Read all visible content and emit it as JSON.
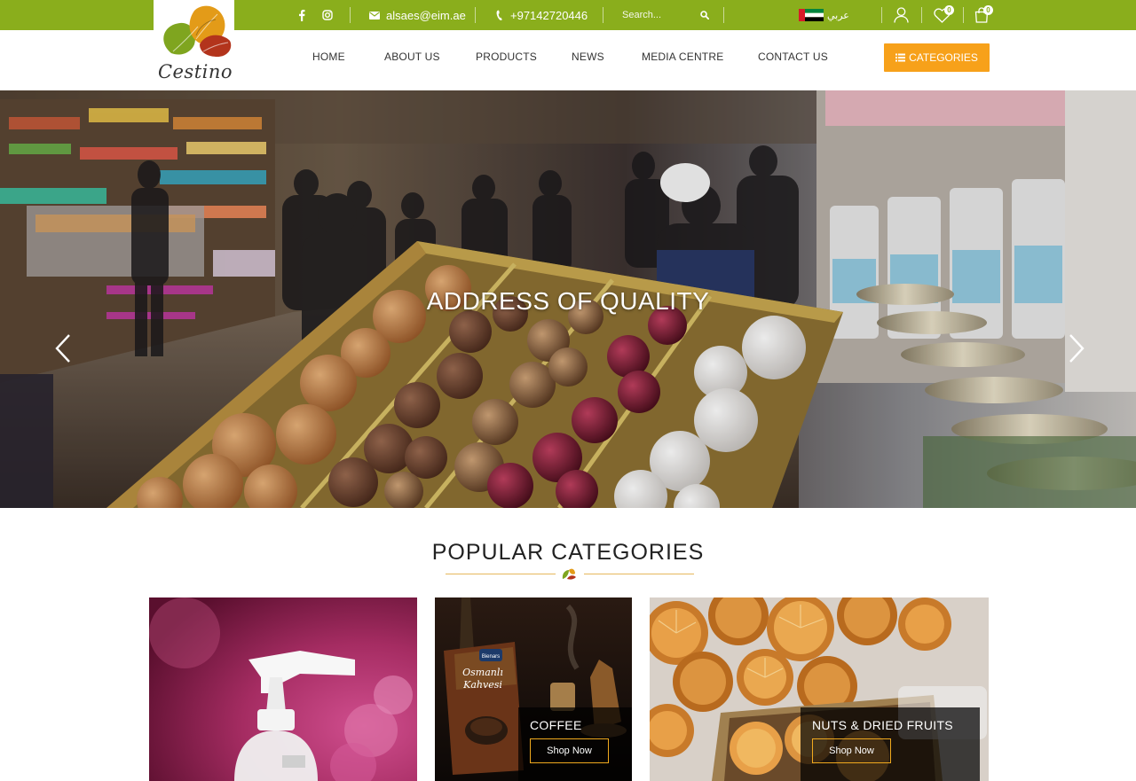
{
  "topbar": {
    "email": "alsaes@eim.ae",
    "phone": "+97142720446",
    "search_placeholder": "Search...",
    "language": "عربي",
    "wishlist_count": "0",
    "cart_count": "0",
    "color": "#8aae1c"
  },
  "logo": {
    "text": "Cestino"
  },
  "nav": {
    "items": [
      {
        "label": "HOME"
      },
      {
        "label": "ABOUT US"
      },
      {
        "label": "PRODUCTS"
      },
      {
        "label": "NEWS"
      },
      {
        "label": "MEDIA CENTRE"
      },
      {
        "label": "CONTACT US"
      }
    ],
    "categories_label": "CATEGORIES",
    "categories_color": "#f7a11a"
  },
  "hero": {
    "title": "ADDRESS OF QUALITY"
  },
  "popular": {
    "title": "POPULAR CATEGORIES",
    "cards": [
      {
        "name": "",
        "cta": ""
      },
      {
        "name": "COFFEE",
        "cta": "Shop Now"
      },
      {
        "name": "NUTS & DRIED FRUITS",
        "cta": "Shop Now"
      }
    ]
  },
  "icons": [
    "facebook-icon",
    "instagram-icon",
    "envelope-icon",
    "phone-icon",
    "search-icon",
    "uae-flag-icon",
    "user-icon",
    "heart-icon",
    "shopping-bag-icon",
    "list-icon",
    "chevron-left-icon",
    "chevron-right-icon"
  ]
}
